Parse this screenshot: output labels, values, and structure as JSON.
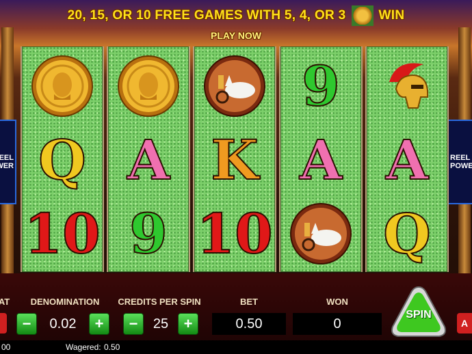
{
  "banner": {
    "line1_prefix": "20, 15, OR 10 FREE GAMES WITH 5, 4, OR 3",
    "line1_suffix": "WIN",
    "line2": "PLAY NOW",
    "scatter_icon": "pompeii-coin-icon"
  },
  "reels": [
    [
      "coin",
      "Q",
      "10"
    ],
    [
      "coin",
      "A",
      "9"
    ],
    [
      "chariot",
      "K",
      "10"
    ],
    [
      "9",
      "A",
      "chariot"
    ],
    [
      "helmet",
      "A",
      "Q"
    ]
  ],
  "side_panels": {
    "left": "REEL POWER",
    "right": "REEL POWER"
  },
  "controls": {
    "left_edge_label": "AT",
    "denomination_label": "DENOMINATION",
    "denomination_value": "0.02",
    "credits_per_spin_label": "CREDITS PER SPIN",
    "credits_per_spin_value": "25",
    "bet_label": "BET",
    "bet_value": "0.50",
    "won_label": "WON",
    "won_value": "0",
    "minus": "−",
    "plus": "+",
    "spin_label": "SPIN",
    "right_edge_label": "A"
  },
  "status": {
    "left_value": "00",
    "wagered_label": "Wagered:",
    "wagered_value": "0.50"
  },
  "colors": {
    "banner_text": "#ffe21a",
    "reel_bg": "#7ccf6a",
    "spin_button": "#3ec820",
    "console_bg": "#3a0808"
  }
}
